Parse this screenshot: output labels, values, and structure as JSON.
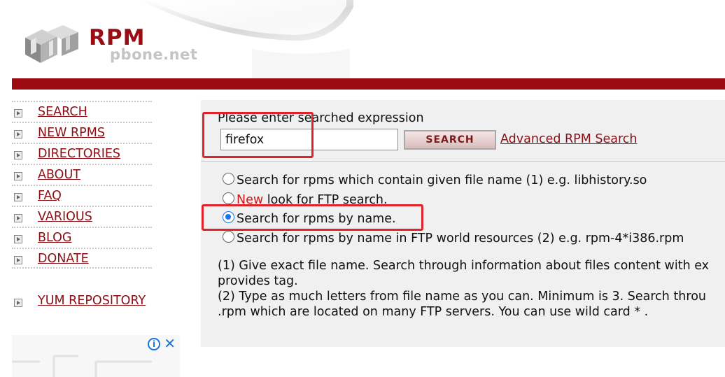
{
  "logo": {
    "brand": "RPM",
    "site": "pbone.net"
  },
  "nav": {
    "items": [
      {
        "label": "SEARCH"
      },
      {
        "label": "NEW RPMS"
      },
      {
        "label": "DIRECTORIES"
      },
      {
        "label": "ABOUT"
      },
      {
        "label": "FAQ"
      },
      {
        "label": "VARIOUS"
      },
      {
        "label": "BLOG"
      },
      {
        "label": "DONATE"
      }
    ],
    "yum": {
      "label": "YUM REPOSITORY"
    }
  },
  "search": {
    "prompt": "Please enter searched expression",
    "value": "firefox",
    "button_label": "SEARCH",
    "advanced_link": "Advanced RPM Search"
  },
  "options": [
    {
      "text": "Search for rpms which contain given file name (1) e.g. libhistory.so",
      "checked": false
    },
    {
      "new_label": "New",
      "text": " look for FTP search.",
      "checked": false
    },
    {
      "text": "Search for rpms by name.",
      "checked": true
    },
    {
      "text": "Search for rpms by name in FTP world resources (2) e.g. rpm-4*i386.rpm",
      "checked": false
    }
  ],
  "notes": {
    "line1": "(1) Give exact file name. Search through information about files content with ex",
    "line2": "provides tag.",
    "line3": "(2) Type as much letters from file name as you can. Minimum is 3. Search throu",
    "line4": ".rpm which are located on many FTP servers. You can use wild card * ."
  },
  "ad": {
    "info_icon": "info-icon",
    "close_icon": "close-icon",
    "close_glyph": "✕",
    "info_glyph": "i"
  },
  "colors": {
    "brand_red": "#9c0a12",
    "link": "#8a0f14",
    "highlight": "#e0232a",
    "radio_accent": "#1a73e8"
  }
}
